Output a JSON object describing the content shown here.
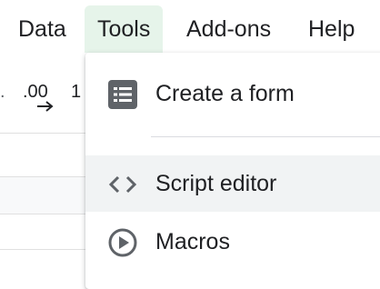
{
  "menubar": {
    "items": [
      {
        "label": "Data"
      },
      {
        "label": "Tools"
      },
      {
        "label": "Add-ons"
      },
      {
        "label": "Help"
      }
    ]
  },
  "toolbar": {
    "left_fragment": ".",
    "decimal_label": ".00",
    "one_label": "1"
  },
  "tools_menu": {
    "items": [
      {
        "label": "Create a form",
        "icon": "form-icon"
      },
      {
        "label": "Script editor",
        "icon": "code-brackets-icon"
      },
      {
        "label": "Macros",
        "icon": "play-circle-icon"
      }
    ]
  },
  "colors": {
    "active_menu_bg": "#e6f4ea",
    "hover_bg": "#f1f3f4",
    "icon_gray": "#5f6368"
  }
}
